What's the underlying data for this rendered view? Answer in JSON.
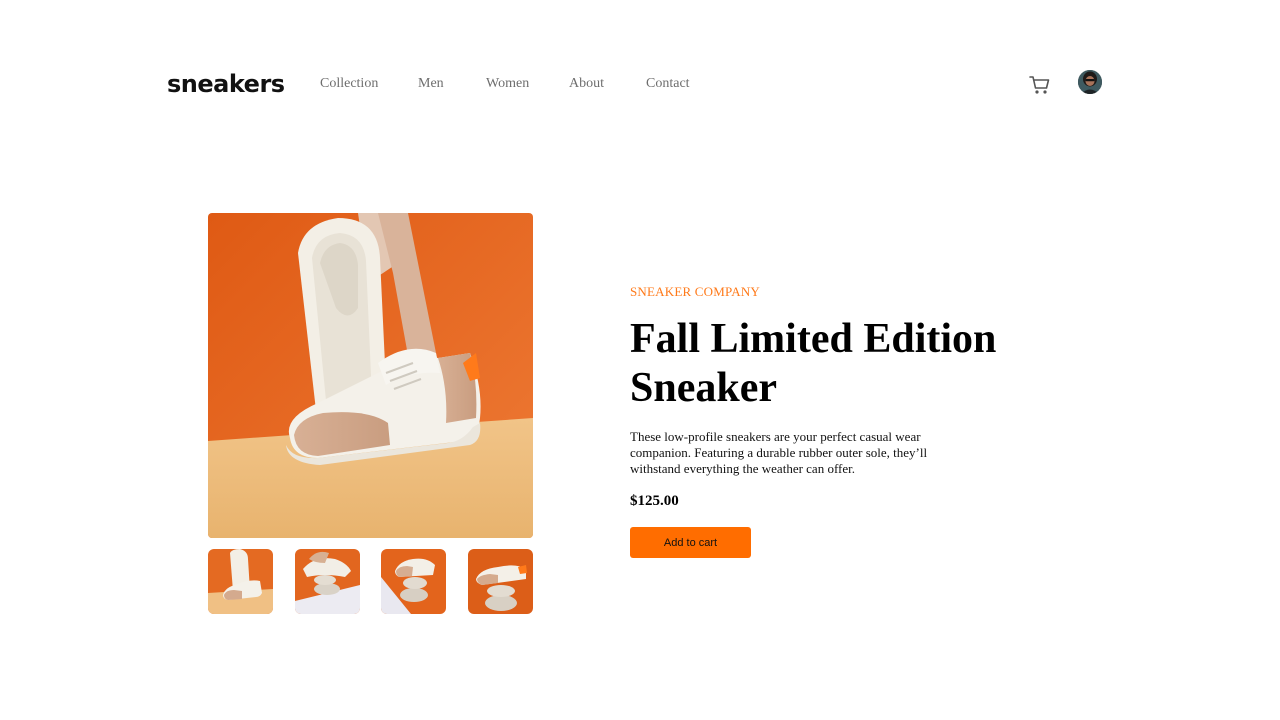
{
  "header": {
    "logo": "sneakers",
    "nav": [
      {
        "label": "Collection"
      },
      {
        "label": "Men"
      },
      {
        "label": "Women"
      },
      {
        "label": "About"
      },
      {
        "label": "Contact"
      }
    ],
    "cart_icon": "cart-icon",
    "avatar_icon": "avatar"
  },
  "gallery": {
    "main_image": "sneaker-photo-orange-background",
    "thumbnails": [
      "thumbnail-1-sneakers-standing",
      "thumbnail-2-sneakers-on-stones",
      "thumbnail-3-sneaker-on-stones",
      "thumbnail-4-sneaker-on-stones"
    ]
  },
  "product": {
    "company": "SNEAKER COMPANY",
    "title_line1": "Fall Limited Edition",
    "title_line2": "Sneaker",
    "description": "These low-profile sneakers are your perfect casual wear companion. Featuring a durable rubber outer sole, they’ll withstand everything the weather can offer.",
    "price": "$125.00",
    "add_to_cart": "Add to cart"
  },
  "colors": {
    "accent": "#ff6d00",
    "company_text": "#ff7a1a",
    "nav_text": "#6e6e6e",
    "photo_orange": "#e4621c",
    "photo_floor": "#efc07d"
  }
}
